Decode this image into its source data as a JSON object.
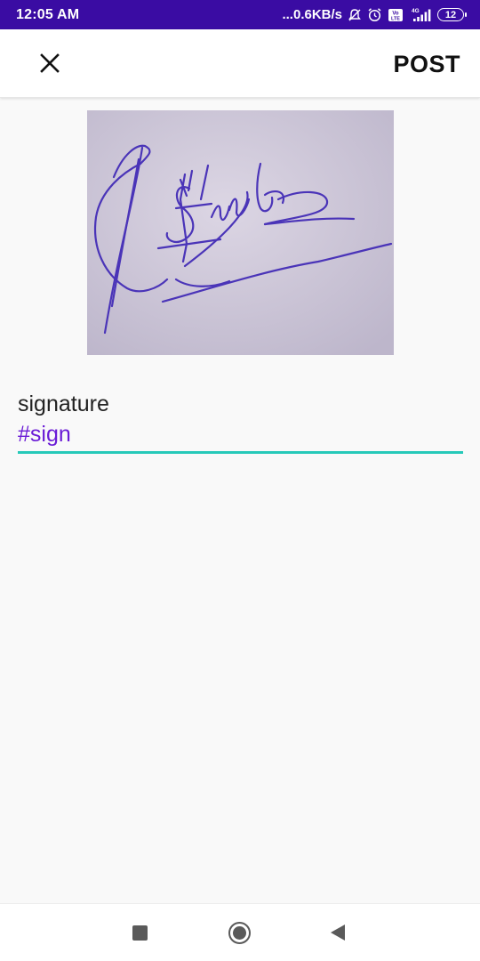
{
  "status_bar": {
    "time": "12:05 AM",
    "network_speed": "...0.6KB/s",
    "volte_label": "Vo LTE",
    "network_type": "4G",
    "battery_level": "12",
    "icons": [
      "mute-icon",
      "alarm-icon",
      "volte-icon",
      "signal-icon",
      "battery-icon"
    ]
  },
  "app_bar": {
    "close_icon": "close-icon",
    "post_label": "POST"
  },
  "post": {
    "image_subject": "handwritten signature",
    "caption_text": "signature",
    "hashtag": "#sign"
  },
  "colors": {
    "status_bar": "#3a0ca3",
    "hashtag": "#6a1bd6",
    "input_underline": "#26c9b9",
    "ink": "#4a34b8"
  },
  "nav_bar": {
    "icons": [
      "recents-icon",
      "home-icon",
      "back-icon"
    ]
  }
}
